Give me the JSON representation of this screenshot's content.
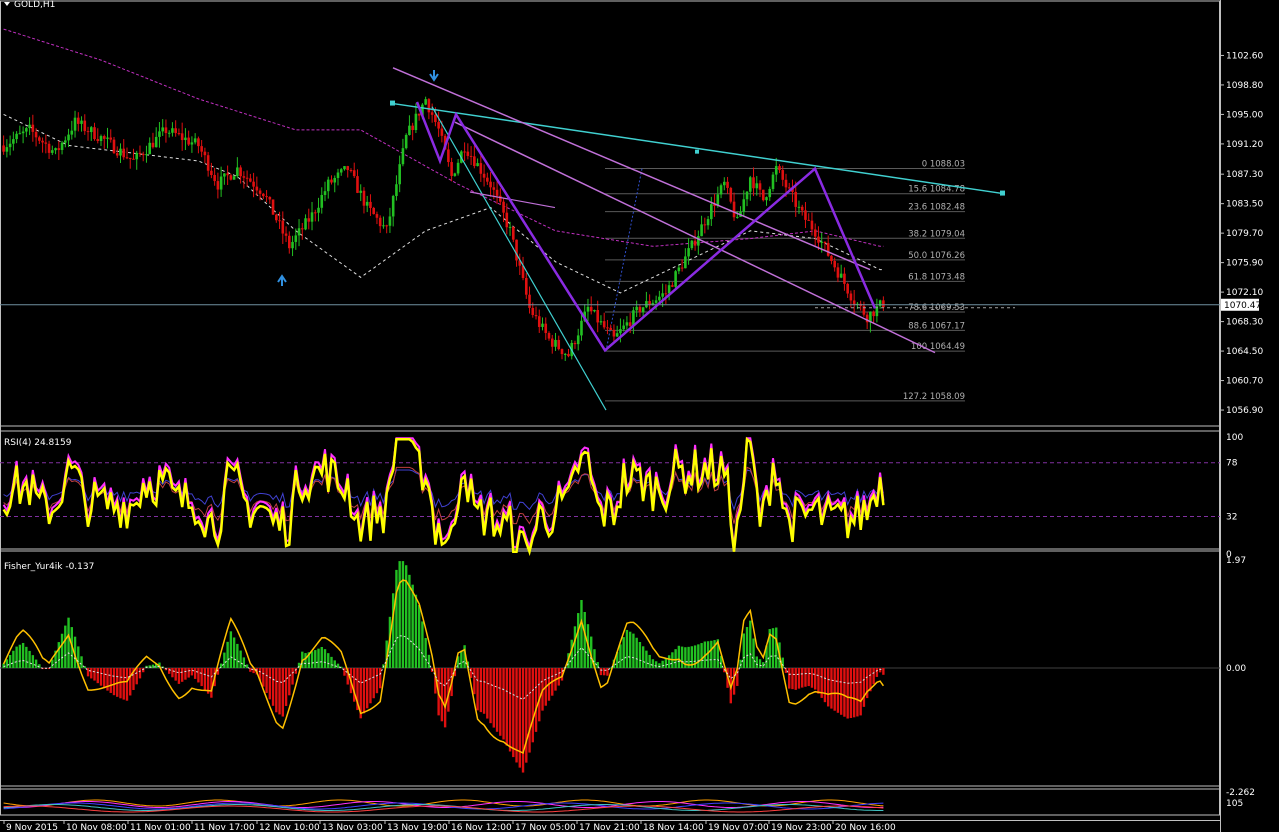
{
  "window_title": "GOLD,H1",
  "chart_data": [
    {
      "type": "candlestick",
      "symbol": "GOLD",
      "timeframe": "H1",
      "title": "GOLD,H1",
      "ylim": [
        1054.2,
        1108.2
      ],
      "price_ticks": [
        "1102.60",
        "1098.80",
        "1095.00",
        "1091.20",
        "1087.30",
        "1083.50",
        "1079.70",
        "1075.90",
        "1072.10",
        "1068.30",
        "1064.50",
        "1060.70",
        "1056.90"
      ],
      "current_price": "1070.47",
      "x_labels": [
        "9 Nov 2015",
        "10 Nov 08:00",
        "11 Nov 01:00",
        "11 Nov 17:00",
        "12 Nov 10:00",
        "13 Nov 03:00",
        "13 Nov 19:00",
        "16 Nov 12:00",
        "17 Nov 05:00",
        "17 Nov 21:00",
        "18 Nov 14:00",
        "19 Nov 07:00",
        "19 Nov 23:00",
        "20 Nov 16:00"
      ],
      "path_points": [
        [
          0,
          1091
        ],
        [
          8,
          1093
        ],
        [
          16,
          1090
        ],
        [
          22,
          1094
        ],
        [
          30,
          1092
        ],
        [
          40,
          1089
        ],
        [
          50,
          1093
        ],
        [
          60,
          1091
        ],
        [
          66,
          1086
        ],
        [
          72,
          1088
        ],
        [
          80,
          1085
        ],
        [
          88,
          1078
        ],
        [
          95,
          1082
        ],
        [
          100,
          1086
        ],
        [
          106,
          1088
        ],
        [
          112,
          1083
        ],
        [
          118,
          1080
        ],
        [
          124,
          1092
        ],
        [
          130,
          1097
        ],
        [
          134,
          1093
        ],
        [
          138,
          1087
        ],
        [
          142,
          1091
        ],
        [
          150,
          1086
        ],
        [
          156,
          1080
        ],
        [
          162,
          1070
        ],
        [
          168,
          1066
        ],
        [
          174,
          1064
        ],
        [
          180,
          1070
        ],
        [
          188,
          1066
        ],
        [
          196,
          1070
        ],
        [
          204,
          1072
        ],
        [
          212,
          1078
        ],
        [
          218,
          1083
        ],
        [
          222,
          1086
        ],
        [
          226,
          1081
        ],
        [
          230,
          1087
        ],
        [
          234,
          1084
        ],
        [
          238,
          1088
        ],
        [
          242,
          1085
        ],
        [
          246,
          1082
        ],
        [
          250,
          1080
        ],
        [
          254,
          1077
        ],
        [
          258,
          1074
        ],
        [
          262,
          1071
        ],
        [
          266,
          1069
        ],
        [
          272,
          1071
        ]
      ],
      "ma_dashed_points": [
        [
          0,
          1095
        ],
        [
          20,
          1091
        ],
        [
          40,
          1090
        ],
        [
          60,
          1089
        ],
        [
          72,
          1087
        ],
        [
          90,
          1080
        ],
        [
          110,
          1074
        ],
        [
          130,
          1080
        ],
        [
          150,
          1083
        ],
        [
          170,
          1076
        ],
        [
          190,
          1072
        ],
        [
          210,
          1076
        ],
        [
          230,
          1080
        ],
        [
          250,
          1079
        ],
        [
          270,
          1075
        ]
      ],
      "ma_slow_points": [
        [
          0,
          1106
        ],
        [
          30,
          1102
        ],
        [
          60,
          1097
        ],
        [
          90,
          1093
        ],
        [
          110,
          1093
        ],
        [
          140,
          1086
        ],
        [
          170,
          1080
        ],
        [
          200,
          1078
        ],
        [
          230,
          1079
        ],
        [
          250,
          1080
        ],
        [
          270,
          1078
        ]
      ],
      "fibonacci_levels": [
        {
          "label": "0 1088.03",
          "price": 1088.03
        },
        {
          "label": "15.6 1084.78",
          "price": 1084.78
        },
        {
          "label": "23.6 1082.48",
          "price": 1082.48
        },
        {
          "label": "38.2 1079.04",
          "price": 1079.04
        },
        {
          "label": "50.0 1076.26",
          "price": 1076.26
        },
        {
          "label": "61.8 1073.48",
          "price": 1073.48
        },
        {
          "label": "78.6 1069.53",
          "price": 1069.53
        },
        {
          "label": "88.6 1067.17",
          "price": 1067.17
        },
        {
          "label": "100 1064.49",
          "price": 1064.49
        },
        {
          "label": "127.2 1058.09",
          "price": 1058.09
        }
      ]
    },
    {
      "type": "line",
      "title": "RSI(4) 24.8159",
      "ylim": [
        0,
        100
      ],
      "levels": [
        78,
        32
      ],
      "y_ticks": [
        "100",
        "78",
        "32",
        "0"
      ]
    },
    {
      "type": "bar",
      "title": "Fisher_Yur4ik -0.137",
      "ylim": [
        -2.262,
        1.97
      ],
      "y_ticks": [
        "1.97",
        "0.00",
        "-2.262"
      ]
    },
    {
      "type": "line",
      "title": "",
      "y_ticks": [
        "105"
      ]
    }
  ],
  "colors": {
    "bull": "#22c022",
    "bear": "#e01010",
    "trend_cyan": "#40d0d0",
    "trend_violet": "#c070d8",
    "zigzag": "#8a2be2",
    "fib": "#808080",
    "rsi": "#ffff00",
    "fisher_line": "#ffc000",
    "ma_slow": "#c030c0",
    "grid_divider": "#c0c0c0"
  }
}
